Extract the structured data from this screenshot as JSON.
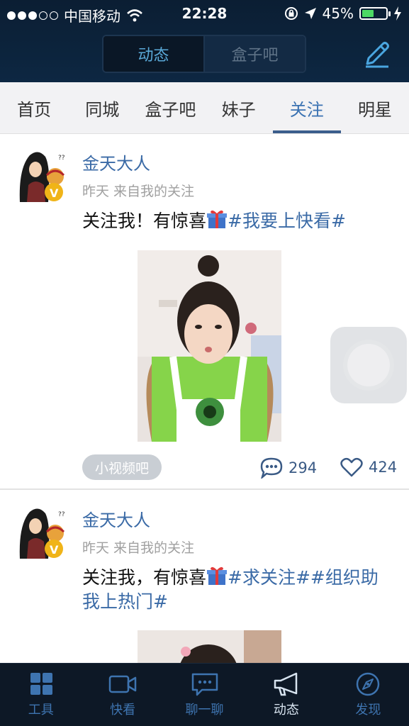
{
  "status_bar": {
    "carrier": "中国移动",
    "time": "22:28",
    "battery": "45%",
    "battery_level": 0.45
  },
  "header": {
    "segments": [
      {
        "label": "动态",
        "active": true
      },
      {
        "label": "盒子吧",
        "active": false
      }
    ],
    "compose_icon": "pencil-icon"
  },
  "categories": [
    {
      "label": "首页",
      "active": false
    },
    {
      "label": "同城",
      "active": false
    },
    {
      "label": "盒子吧",
      "active": false
    },
    {
      "label": "妹子",
      "active": false
    },
    {
      "label": "关注",
      "active": true
    },
    {
      "label": "明星",
      "active": false
    }
  ],
  "posts": [
    {
      "author": "金天大人",
      "meta": "昨天 来自我的关注",
      "text": "关注我！有惊喜",
      "hashtag": "#我要上快看#",
      "chip": "小视频吧",
      "comments": "294",
      "likes": "424"
    },
    {
      "author": "金天大人",
      "meta": "昨天 来自我的关注",
      "text": "关注我，有惊喜",
      "hashtag": "#求关注##组织助我上热门#"
    }
  ],
  "tabbar": [
    {
      "label": "工具",
      "icon": "grid-icon",
      "active": false
    },
    {
      "label": "快看",
      "icon": "video-camera-icon",
      "active": false
    },
    {
      "label": "聊一聊",
      "icon": "chat-icon",
      "active": false
    },
    {
      "label": "动态",
      "icon": "megaphone-icon",
      "active": true
    },
    {
      "label": "发现",
      "icon": "compass-icon",
      "active": false
    }
  ],
  "colors": {
    "accent": "#3a72b2",
    "header_bg": "#0d2742",
    "tabbar_bg": "#0d1826"
  }
}
